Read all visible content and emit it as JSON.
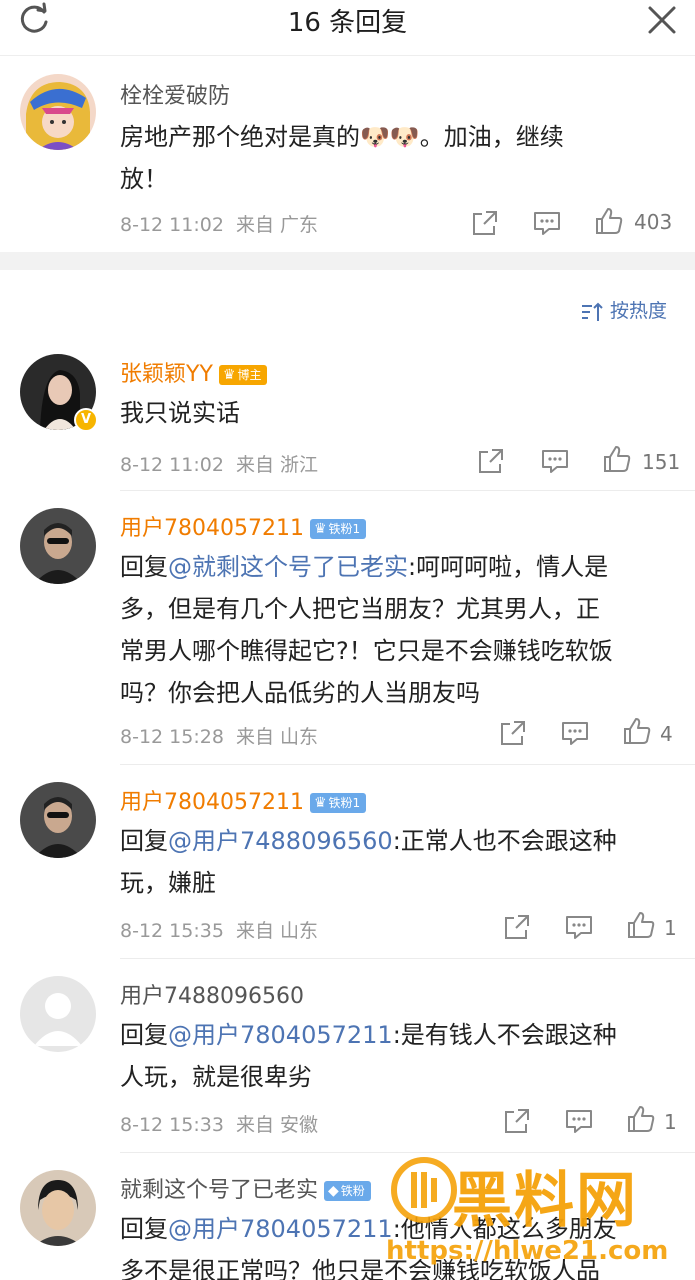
{
  "header": {
    "title": "16 条回复",
    "refresh_icon": "refresh-icon",
    "close_icon": "close-icon"
  },
  "root_comment": {
    "author": "栓栓爱破防",
    "text": "房地产那个绝对是真的🐶🐶。加油，继续放！",
    "text_line1": "房地产那个绝对是真的",
    "emoji": "🐶🐶",
    "text_line1_tail": "。加油，继续",
    "text_line2": "放！",
    "time": "8-12 11:02",
    "source": "来自 广东",
    "likes": "403"
  },
  "sort": {
    "label": "按热度"
  },
  "replies": [
    {
      "author": "张颖颖YY",
      "badge": "博主",
      "verified": true,
      "text": "我只说实话",
      "time": "8-12 11:02",
      "source": "来自 浙江",
      "likes": "151"
    },
    {
      "author": "用户7804057211",
      "badge": "铁粉1",
      "prefix": "回复",
      "mention": "@就剩这个号了已老实",
      "body": ":呵呵呵啦，情人是多，但是有几个人把它当朋友？尤其男人，正常男人哪个瞧得起它?！它只是不会赚钱吃软饭吗？你会把人品低劣的人当朋友吗",
      "lines": [
        ":呵呵呵啦，情人是",
        "多，但是有几个人把它当朋友？尤其男人，正",
        "常男人哪个瞧得起它?！它只是不会赚钱吃软饭",
        "吗？你会把人品低劣的人当朋友吗"
      ],
      "time": "8-12 15:28",
      "source": "来自 山东",
      "likes": "4"
    },
    {
      "author": "用户7804057211",
      "badge": "铁粉1",
      "prefix": "回复",
      "mention": "@用户7488096560",
      "lines": [
        ":正常人也不会跟这种",
        "玩，嫌脏"
      ],
      "time": "8-12 15:35",
      "source": "来自 山东",
      "likes": "1"
    },
    {
      "author": "用户7488096560",
      "prefix": "回复",
      "mention": "@用户7804057211",
      "lines": [
        ":是有钱人不会跟这种",
        "人玩，就是很卑劣"
      ],
      "time": "8-12 15:33",
      "source": "来自 安徽",
      "likes": "1"
    },
    {
      "author": "就剩这个号了已老实",
      "badge": "铁粉",
      "prefix": "回复",
      "mention": "@用户7804057211",
      "lines": [
        ":他情人都这么多朋友",
        "多不是很正常吗？他只是不会赚钱吃软饭人品"
      ]
    }
  ],
  "watermark": {
    "text": "黑料网",
    "url": "https://hlwe21.com"
  },
  "colors": {
    "accent_blue": "#4d74b3",
    "vip_orange": "#f07c00",
    "boss_badge": "#f7a600",
    "fan_badge": "#6aa9ea",
    "watermark": "#f5a20a"
  }
}
